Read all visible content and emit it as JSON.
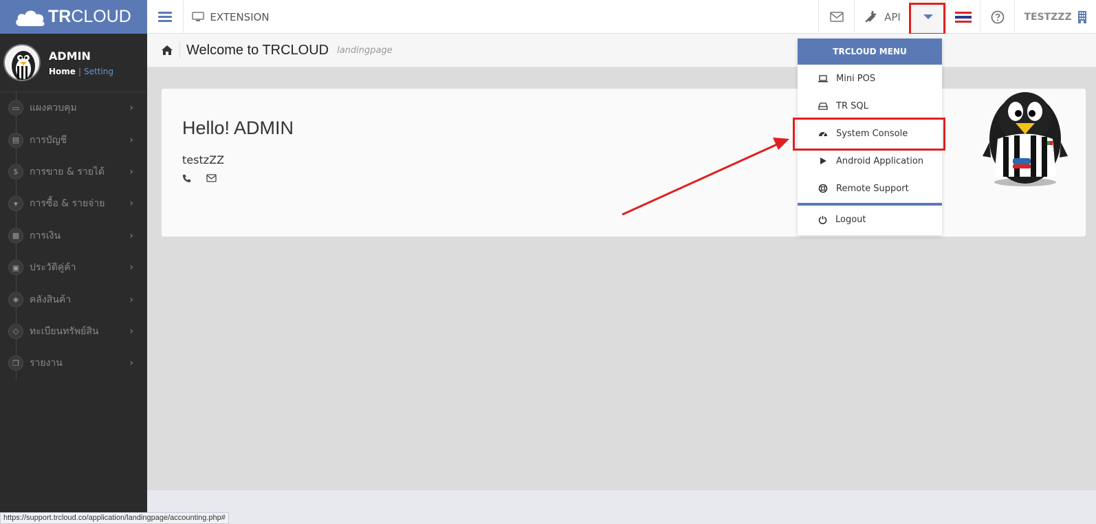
{
  "brand": {
    "bold": "TR",
    "light": "CLOUD"
  },
  "topbar": {
    "extension_label": "EXTENSION",
    "api_label": "API",
    "user_label": "TESTZZZ"
  },
  "sidebar": {
    "profile": {
      "name": "ADMIN",
      "home_link": "Home",
      "separator": "|",
      "setting_link": "Setting"
    },
    "items": [
      {
        "label": "แผงควบคุม",
        "icon": "monitor-icon"
      },
      {
        "label": "การบัญชี",
        "icon": "book-icon"
      },
      {
        "label": "การขาย & รายได้",
        "icon": "dollar-icon"
      },
      {
        "label": "การซื้อ & รายจ่าย",
        "icon": "cart-icon"
      },
      {
        "label": "การเงิน",
        "icon": "calendar-icon"
      },
      {
        "label": "ประวัติคู่ค้า",
        "icon": "contact-book-icon"
      },
      {
        "label": "คลังสินค้า",
        "icon": "cubes-icon"
      },
      {
        "label": "ทะเบียนทรัพย์สิน",
        "icon": "diamond-icon"
      },
      {
        "label": "รายงาน",
        "icon": "copy-icon"
      }
    ]
  },
  "page": {
    "title": "Welcome to TRCLOUD",
    "subtitle": "landingpage",
    "greeting": "Hello! ADMIN",
    "company": "testzZZ"
  },
  "menu": {
    "header": "TRCLOUD MENU",
    "items": [
      {
        "label": "Mini POS",
        "icon": "laptop-icon"
      },
      {
        "label": "TR SQL",
        "icon": "hdd-icon"
      },
      {
        "label": "System Console",
        "icon": "dashboard-icon"
      },
      {
        "label": "Android Application",
        "icon": "play-icon"
      },
      {
        "label": "Remote Support",
        "icon": "lifebuoy-icon"
      }
    ],
    "logout": "Logout"
  },
  "statusbar": {
    "url": "https://support.trcloud.co/application/landingpage/accounting.php#"
  },
  "colors": {
    "brand": "#5b7ab5",
    "sidebar": "#2b2b2b",
    "highlight": "#e02020"
  }
}
